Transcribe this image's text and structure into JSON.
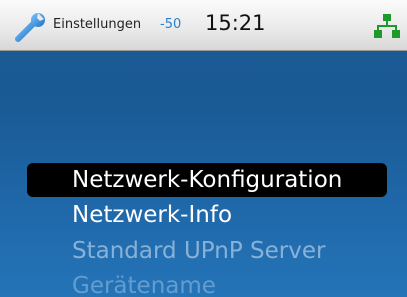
{
  "status_bar": {
    "icon": "wrench-icon",
    "title": "Einstellungen",
    "signal": "-50",
    "time": "15:21",
    "network_icon": "network-icon",
    "network_color": "#1f9a2a"
  },
  "menu": {
    "items": [
      {
        "label": "Netzwerk-Konfiguration",
        "selected": true
      },
      {
        "label": "Netzwerk-Info",
        "selected": false
      },
      {
        "label": "Standard UPnP Server",
        "selected": false
      },
      {
        "label": "Gerätename",
        "selected": false
      }
    ]
  },
  "colors": {
    "background": "#1c5a91",
    "selection": "#000000",
    "signal_text": "#2a7fd0"
  }
}
